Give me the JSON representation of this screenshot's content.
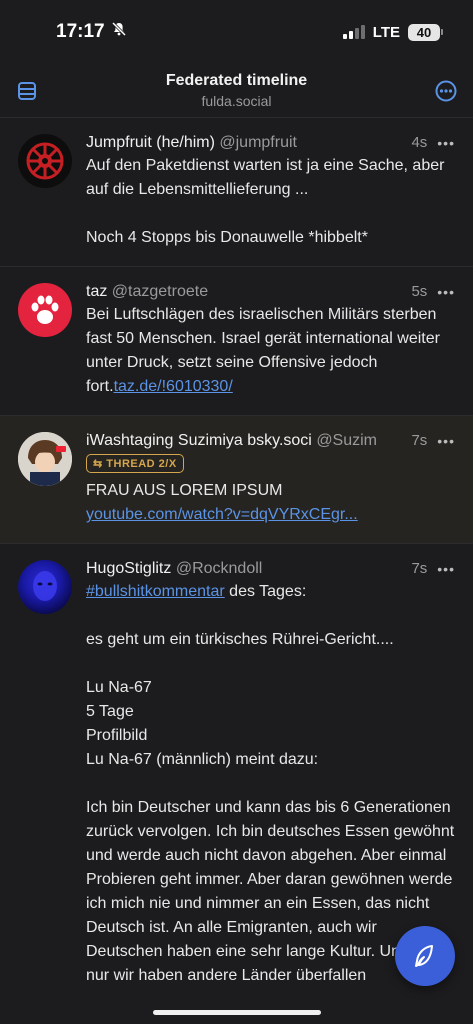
{
  "status": {
    "time": "17:17",
    "network": "LTE",
    "battery": "40"
  },
  "nav": {
    "title": "Federated timeline",
    "subtitle": "fulda.social"
  },
  "posts": [
    {
      "name": "Jumpfruit (he/him)",
      "handle": "@jumpfruit",
      "time": "4s",
      "paragraphs": [
        "Auf den Paketdienst warten ist ja eine Sache, aber auf die Lebensmittellieferung ...",
        "Noch 4 Stopps bis Donauwelle *hibbelt*"
      ]
    },
    {
      "name": "taz",
      "handle": "@tazgetroete",
      "time": "5s",
      "text": "Bei Luftschlägen des israelischen Militärs sterben fast 50 Menschen. Israel gerät international weiter unter Druck, setzt seine Offensive jedoch fort.",
      "link": "taz.de/!6010330/"
    },
    {
      "name": "iWashtaging Suzimiya bsky.soci",
      "handle": "@Suzim",
      "time": "7s",
      "badge": "THREAD 2/X",
      "text": "FRAU AUS LOREM IPSUM",
      "link": "youtube.com/watch?v=dqVYRxCEgr..."
    },
    {
      "name": "HugoStiglitz",
      "handle": "@Rockndoll",
      "time": "7s",
      "hashtag": "#bullshitkommentar",
      "after_hashtag": " des Tages:",
      "lines": [
        "",
        "es geht um ein türkisches Rührei-Gericht....",
        "",
        "Lu Na-67",
        "5 Tage",
        "Profilbild",
        "Lu Na-67 (männlich) meint dazu:",
        "",
        "Ich bin Deutscher und kann das bis 6 Generationen zurück vervolgen. Ich bin deutsches Essen gewöhnt und werde auch nicht davon abgehen. Aber einmal Probieren geht immer. Aber daran gewöhnen werde ich mich nie und nimmer an ein Essen, das nicht Deutsch ist. An alle Emigranten, auch wir Deutschen haben eine sehr lange Kultur. Und nicht nur wir haben andere Länder überfallen"
      ]
    }
  ],
  "colors": {
    "accent": "#5b93e6",
    "background": "#1c1c1e",
    "thread_badge": "#d5a64d",
    "fab": "#3b5fd8"
  }
}
